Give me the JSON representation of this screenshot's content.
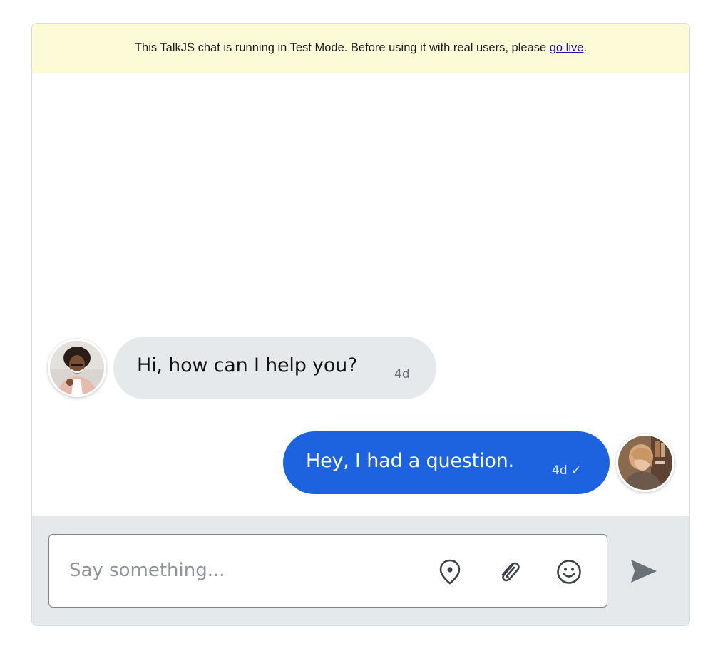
{
  "banner": {
    "text": "This TalkJS chat is running in Test Mode. Before using it with real users, please ",
    "link_label": "go live",
    "suffix": "."
  },
  "messages": [
    {
      "direction": "incoming",
      "text": "Hi, how can I help you?",
      "time": "4d"
    },
    {
      "direction": "outgoing",
      "text": "Hey, I had a question.",
      "time": "4d ✓"
    }
  ],
  "composer": {
    "placeholder": "Say something...",
    "value": "",
    "icons": [
      "location-pin-icon",
      "paperclip-icon",
      "smiley-icon",
      "send-arrow-icon"
    ]
  },
  "colors": {
    "banner_bg": "#fdfad8",
    "incoming_bubble": "#e6e9ec",
    "outgoing_bubble": "#1d63e0",
    "composer_bg": "#e6e9ec",
    "link": "#1a0dab"
  }
}
